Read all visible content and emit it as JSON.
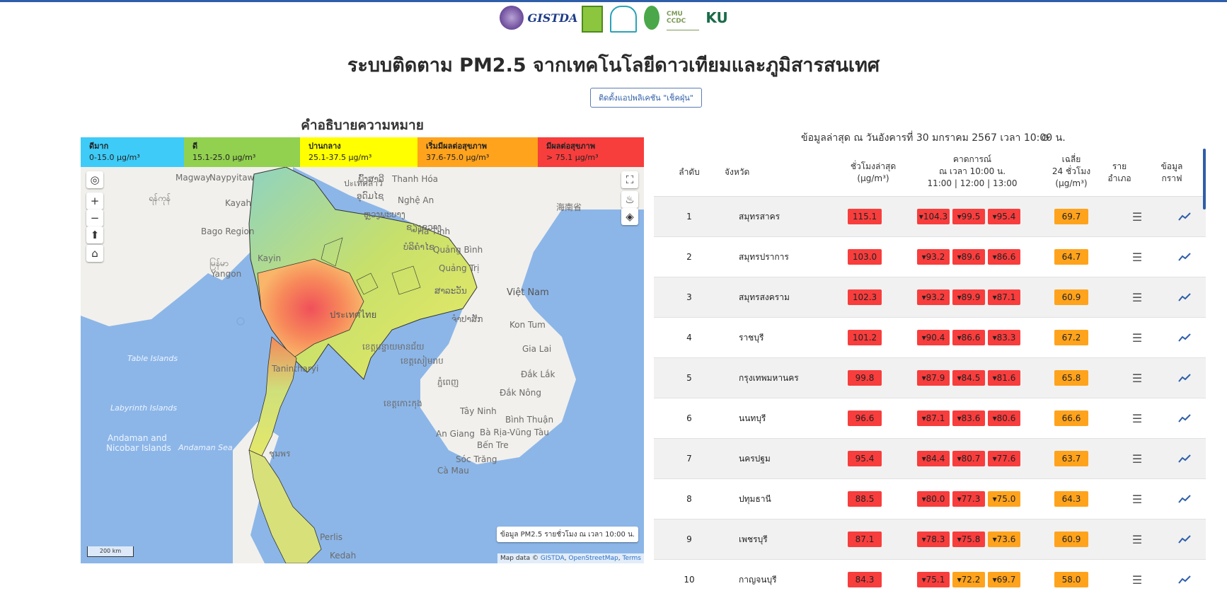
{
  "header": {
    "title": "ระบบติดตาม PM2.5 จากเทคโนโลยีดาวเทียมและภูมิสารสนเทศ",
    "app_button": "ติดตั้งแอปพลิเคชัน \"เช็คฝุ่น\"",
    "logos": [
      "seal-logo",
      "GISTDA",
      "square-logo",
      "arch-logo",
      "tree-logo",
      "CMU CCDC",
      "KU"
    ]
  },
  "legend": {
    "title": "คำอธิบายความหมาย",
    "items": [
      {
        "label": "ดีมาก",
        "range": "0-15.0 µg/m³",
        "color": "#3ecbf7"
      },
      {
        "label": "ดี",
        "range": "15.1-25.0 µg/m³",
        "color": "#92d050"
      },
      {
        "label": "ปานกลาง",
        "range": "25.1-37.5 µg/m³",
        "color": "#ffff00"
      },
      {
        "label": "เริ่มมีผลต่อสุขภาพ",
        "range": "37.6-75.0 µg/m³",
        "color": "#ffa31c"
      },
      {
        "label": "มีผลต่อสุขภาพ",
        "range": "> 75.1 µg/m³",
        "color": "#f83d3d"
      }
    ]
  },
  "map": {
    "info": "ข้อมูล PM2.5 รายชั่วโมง ณ เวลา 10:00 น.",
    "scale": "200 km",
    "attribution_prefix": "Map data ©",
    "attribution_links": [
      "GISTDA",
      "OpenStreetMap",
      "Terms"
    ],
    "labels": {
      "magway": "Magway",
      "naypyitaw": "Naypyitaw",
      "mandalay": "ရန်ကုန်",
      "kayah": "Kayah",
      "bago": "Bago Region",
      "kayin": "Kayin",
      "yangon_mm": "မြန်မာ",
      "yangon": "Yangon",
      "thanhhoa": "Thanh Hóa",
      "nghean": "Nghệ An",
      "hatinh": "Hà Tĩnh",
      "quangbinh": "Quảng Bình",
      "quangtri": "Quảng Trị",
      "vietnam": "Việt Nam",
      "konum": "Kon Tum",
      "gialai": "Gia Lai",
      "daklak": "Đắk Lắk",
      "daknong": "Đắk Nông",
      "tayninh": "Tây Ninh",
      "binhthuan": "Bình Thuận",
      "angiang": "An Giang",
      "baria": "Bà Rịa-Vũng Tàu",
      "bentre": "Bến Tre",
      "soctrang": "Sóc Trăng",
      "camau": "Cà Mau",
      "hainan": "海南省",
      "thailand": "ประเทศไทย",
      "tanintharyi": "Tanintharyi",
      "table": "Table Islands",
      "labyrinth": "Labyrinth Islands",
      "andaman": "Andaman and",
      "nicobar": "Nicobar Islands",
      "andamansea": "Andaman Sea",
      "perlis": "Perlis",
      "kedah": "Kedah",
      "laos1": "ปะเทดลาว",
      "laos2": "ສາລະວັນ",
      "khmer1": "ខេត្តបន្ទាយមានជ័យ",
      "khmer2": "ខេត្តសៀមរាប",
      "khmer3": "ខេត្តកោះកុង",
      "khmer4": "ភ្នំពេញ",
      "laos3": "ຈຳປາສັກ",
      "laos4": "ຫຼວງພະບາງ",
      "laos5": "ອຸດົມໄຊ",
      "laos6": "ພົ້ງສາລີ",
      "laos7": "ຊຽງຂວາງ",
      "laos8": "ບໍລິຄໍາໄຊ",
      "thaicol": "ชุมพร"
    }
  },
  "table": {
    "update_text": "ข้อมูลล่าสุด ณ วันอังคารที่ 30 มกราคม 2567 เวลา 10:00 น.",
    "headers": {
      "rank": "ลำดับ",
      "province": "จังหวัด",
      "latest_1": "ชั่วโมงล่าสุด",
      "latest_2": "(µg/m³)",
      "forecast_1": "คาดการณ์",
      "forecast_2": "ณ เวลา 10:00 น.",
      "forecast_3": "11:00 | 12:00 | 13:00",
      "avg_1": "เฉลี่ย",
      "avg_2": "24 ชั่วโมง",
      "avg_3": "(µg/m³)",
      "district_1": "ราย",
      "district_2": "อำเภอ",
      "graph_1": "ข้อมูล",
      "graph_2": "กราฟ"
    },
    "rows": [
      {
        "rank": "1",
        "province": "สมุทรสาคร",
        "latest": "115.1",
        "forecast": [
          {
            "v": "▾104.3",
            "c": "red"
          },
          {
            "v": "▾99.5",
            "c": "red"
          },
          {
            "v": "▾95.4",
            "c": "red"
          }
        ],
        "avg": "69.7"
      },
      {
        "rank": "2",
        "province": "สมุทรปราการ",
        "latest": "103.0",
        "forecast": [
          {
            "v": "▾93.2",
            "c": "red"
          },
          {
            "v": "▾89.6",
            "c": "red"
          },
          {
            "v": "▾86.6",
            "c": "red"
          }
        ],
        "avg": "64.7"
      },
      {
        "rank": "3",
        "province": "สมุทรสงคราม",
        "latest": "102.3",
        "forecast": [
          {
            "v": "▾93.2",
            "c": "red"
          },
          {
            "v": "▾89.9",
            "c": "red"
          },
          {
            "v": "▾87.1",
            "c": "red"
          }
        ],
        "avg": "60.9"
      },
      {
        "rank": "4",
        "province": "ราชบุรี",
        "latest": "101.2",
        "forecast": [
          {
            "v": "▾90.4",
            "c": "red"
          },
          {
            "v": "▾86.6",
            "c": "red"
          },
          {
            "v": "▾83.3",
            "c": "red"
          }
        ],
        "avg": "67.2"
      },
      {
        "rank": "5",
        "province": "กรุงเทพมหานคร",
        "latest": "99.8",
        "forecast": [
          {
            "v": "▾87.9",
            "c": "red"
          },
          {
            "v": "▾84.5",
            "c": "red"
          },
          {
            "v": "▾81.6",
            "c": "red"
          }
        ],
        "avg": "65.8"
      },
      {
        "rank": "6",
        "province": "นนทบุรี",
        "latest": "96.6",
        "forecast": [
          {
            "v": "▾87.1",
            "c": "red"
          },
          {
            "v": "▾83.6",
            "c": "red"
          },
          {
            "v": "▾80.6",
            "c": "red"
          }
        ],
        "avg": "66.6"
      },
      {
        "rank": "7",
        "province": "นครปฐม",
        "latest": "95.4",
        "forecast": [
          {
            "v": "▾84.4",
            "c": "red"
          },
          {
            "v": "▾80.7",
            "c": "red"
          },
          {
            "v": "▾77.6",
            "c": "red"
          }
        ],
        "avg": "63.7"
      },
      {
        "rank": "8",
        "province": "ปทุมธานี",
        "latest": "88.5",
        "forecast": [
          {
            "v": "▾80.0",
            "c": "red"
          },
          {
            "v": "▾77.3",
            "c": "red"
          },
          {
            "v": "▾75.0",
            "c": "orange"
          }
        ],
        "avg": "64.3"
      },
      {
        "rank": "9",
        "province": "เพชรบุรี",
        "latest": "87.1",
        "forecast": [
          {
            "v": "▾78.3",
            "c": "red"
          },
          {
            "v": "▾75.8",
            "c": "red"
          },
          {
            "v": "▾73.6",
            "c": "orange"
          }
        ],
        "avg": "60.9"
      },
      {
        "rank": "10",
        "province": "กาญจนบุรี",
        "latest": "84.3",
        "forecast": [
          {
            "v": "▾75.1",
            "c": "red"
          },
          {
            "v": "▾72.2",
            "c": "orange"
          },
          {
            "v": "▾69.7",
            "c": "orange"
          }
        ],
        "avg": "58.0"
      }
    ]
  }
}
